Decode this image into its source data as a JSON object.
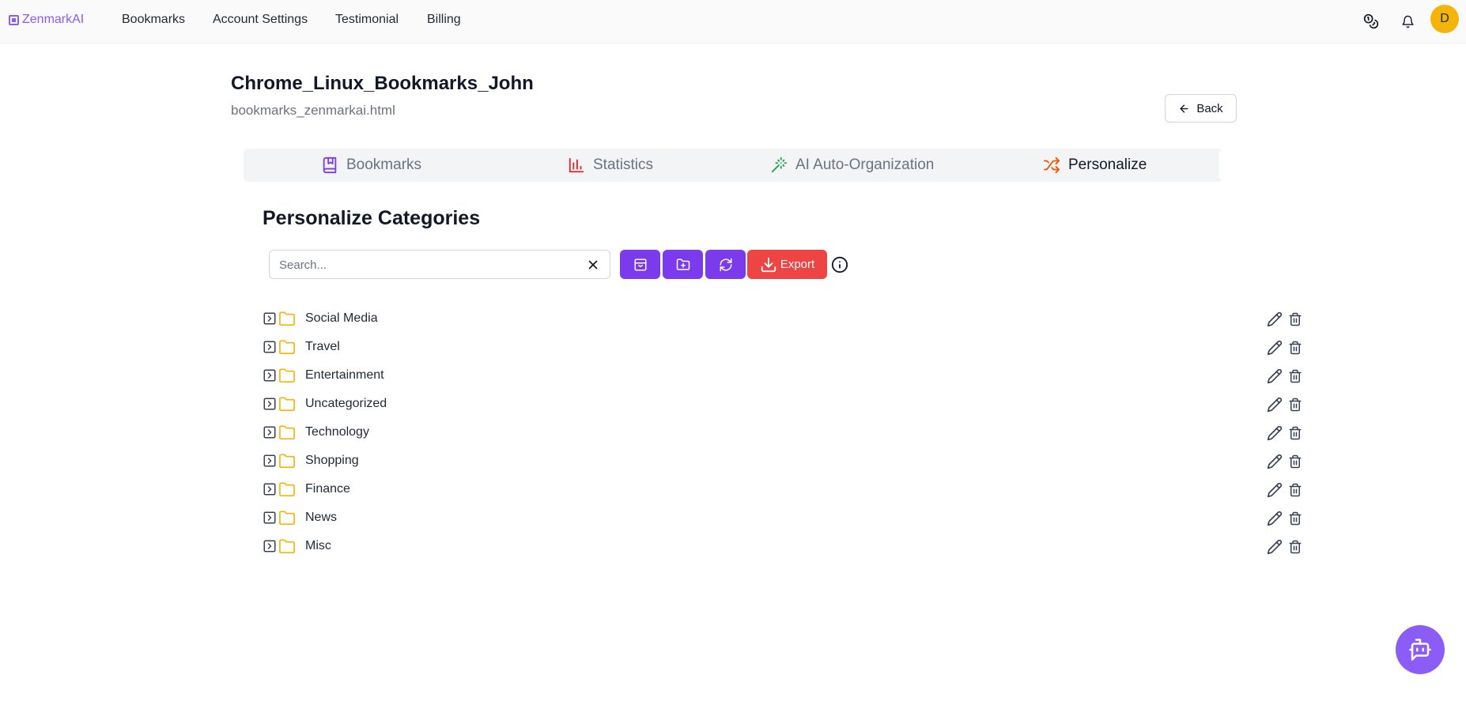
{
  "app": {
    "name": "ZenmarkAI"
  },
  "nav": {
    "links": [
      "Bookmarks",
      "Account Settings",
      "Testimonial",
      "Billing"
    ],
    "avatar_initial": "D"
  },
  "header": {
    "title": "Chrome_Linux_Bookmarks_John",
    "subtitle": "bookmarks_zenmarkai.html",
    "back_label": "Back"
  },
  "tabs": [
    {
      "label": "Bookmarks",
      "icon": "bookmark-book-icon",
      "color": "#7c3aed"
    },
    {
      "label": "Statistics",
      "icon": "bar-chart-icon",
      "color": "#dc2626"
    },
    {
      "label": "AI Auto-Organization",
      "icon": "magic-wand-icon",
      "color": "#16a34a"
    },
    {
      "label": "Personalize",
      "icon": "shuffle-icon",
      "color": "#ea580c",
      "active": true
    }
  ],
  "section": {
    "title": "Personalize Categories",
    "search_placeholder": "Search...",
    "export_label": "Export"
  },
  "categories": [
    "Social Media",
    "Travel",
    "Entertainment",
    "Uncategorized",
    "Technology",
    "Shopping",
    "Finance",
    "News",
    "Misc"
  ],
  "colors": {
    "brand": "#8b5cf6",
    "primary_button": "#7c3aed",
    "export_button": "#ef4444",
    "folder": "#f5b40a",
    "avatar": "#f5b40a"
  }
}
